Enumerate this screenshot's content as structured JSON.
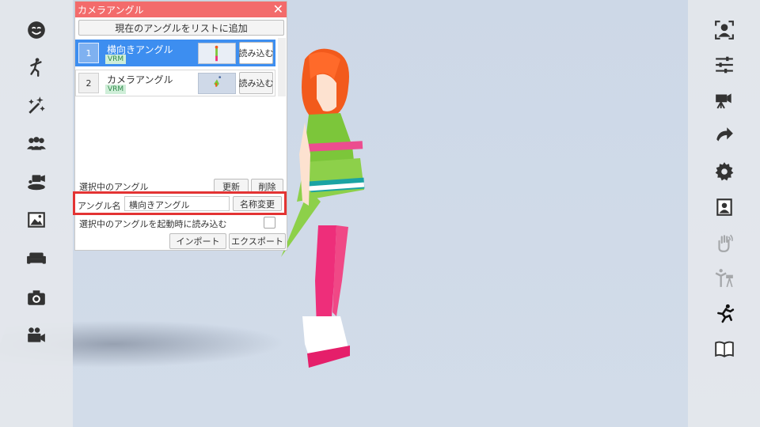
{
  "panel": {
    "title": "カメラアングル",
    "close_symbol": "✕",
    "add_button": "現在のアングルをリストに追加",
    "items": [
      {
        "index": "1",
        "name": "横向きアングル",
        "tag": "VRM",
        "load": "読み込む",
        "selected": true
      },
      {
        "index": "2",
        "name": "カメラアングル",
        "tag": "VRM",
        "load": "読み込む",
        "selected": false
      }
    ],
    "selected_label": "選択中のアングル",
    "update_button": "更新",
    "delete_button": "削除",
    "name_label": "アングル名",
    "name_value": "横向きアングル",
    "rename_button": "名称変更",
    "startup_label": "選択中のアングルを起動時に読み込む",
    "import_button": "インポート",
    "export_button": "エクスポート"
  },
  "left_toolbar": [
    "face-icon",
    "pose-icon",
    "magic-wand-icon",
    "group-icon",
    "camera-stage-icon",
    "image-icon",
    "sofa-icon",
    "camera-icon",
    "video-camera-icon"
  ],
  "right_toolbar": [
    "portrait-icon",
    "sliders-icon",
    "video-camera-icon",
    "redo-icon",
    "gear-icon",
    "picture-frame-icon",
    "hand-wave-icon",
    "tripod-person-icon",
    "running-icon",
    "book-icon"
  ],
  "colors": {
    "header": "#f36b6b",
    "selected": "#3d8ef0",
    "highlight": "#e33333",
    "background": "#cdd8e7"
  }
}
